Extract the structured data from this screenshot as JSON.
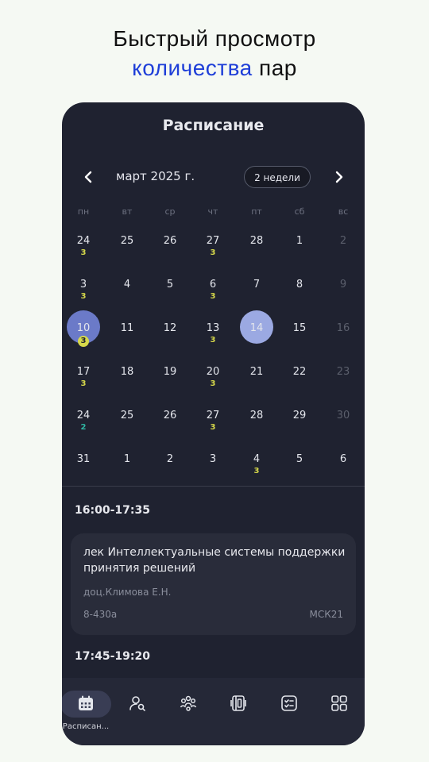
{
  "promo": {
    "line1": "Быстрый просмотр",
    "accent": "количества",
    "rest": " пар"
  },
  "header": {
    "title": "Расписание"
  },
  "calendar": {
    "month_label": "март 2025 г.",
    "range_label": "2 недели",
    "weekdays": [
      "пн",
      "вт",
      "ср",
      "чт",
      "пт",
      "сб",
      "вс"
    ],
    "weeks": [
      [
        {
          "d": "24",
          "c": "3"
        },
        {
          "d": "25"
        },
        {
          "d": "26"
        },
        {
          "d": "27",
          "c": "3"
        },
        {
          "d": "28"
        },
        {
          "d": "1"
        },
        {
          "d": "2",
          "dim": true
        }
      ],
      [
        {
          "d": "3",
          "c": "3"
        },
        {
          "d": "4"
        },
        {
          "d": "5"
        },
        {
          "d": "6",
          "c": "3"
        },
        {
          "d": "7"
        },
        {
          "d": "8"
        },
        {
          "d": "9",
          "dim": true
        }
      ],
      [
        {
          "d": "10",
          "c": "3",
          "sel": true
        },
        {
          "d": "11"
        },
        {
          "d": "12"
        },
        {
          "d": "13",
          "c": "3"
        },
        {
          "d": "14",
          "today": true
        },
        {
          "d": "15"
        },
        {
          "d": "16",
          "dim": true
        }
      ],
      [
        {
          "d": "17",
          "c": "3"
        },
        {
          "d": "18"
        },
        {
          "d": "19"
        },
        {
          "d": "20",
          "c": "3"
        },
        {
          "d": "21"
        },
        {
          "d": "22"
        },
        {
          "d": "23",
          "dim": true
        }
      ],
      [
        {
          "d": "24",
          "c": "2",
          "teal": true
        },
        {
          "d": "25"
        },
        {
          "d": "26"
        },
        {
          "d": "27",
          "c": "3"
        },
        {
          "d": "28"
        },
        {
          "d": "29"
        },
        {
          "d": "30",
          "dim": true
        }
      ],
      [
        {
          "d": "31"
        },
        {
          "d": "1"
        },
        {
          "d": "2"
        },
        {
          "d": "3"
        },
        {
          "d": "4",
          "c": "3"
        },
        {
          "d": "5"
        },
        {
          "d": "6"
        }
      ]
    ]
  },
  "schedule": {
    "slot1_time": "16:00-17:35",
    "lesson": {
      "subject": "лек Интеллектуальные системы поддержки принятия решений",
      "teacher": "доц.Климова Е.Н.",
      "room": "8-430а",
      "group": "МСК21"
    },
    "slot2_time": "17:45-19:20"
  },
  "tabbar": {
    "items": [
      {
        "icon": "calendar-icon",
        "label": "Расписан...",
        "active": true
      },
      {
        "icon": "teacher-search-icon"
      },
      {
        "icon": "groups-icon"
      },
      {
        "icon": "rooms-icon"
      },
      {
        "icon": "tasks-icon"
      },
      {
        "icon": "apps-grid-icon"
      }
    ]
  },
  "colors": {
    "accent": "#1f3fd8",
    "selected": "#6b7ac8",
    "today": "#9ba9e2",
    "count": "#d6d84a",
    "count_alt": "#2fb6a3"
  }
}
